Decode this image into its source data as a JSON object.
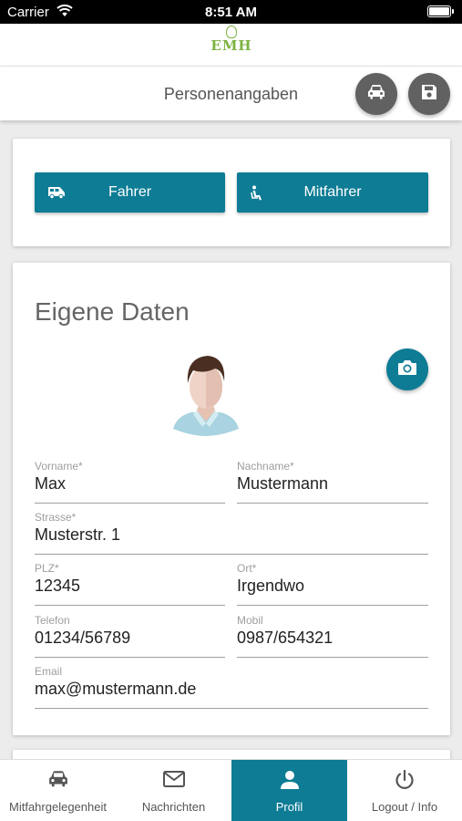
{
  "status_bar": {
    "carrier": "Carrier",
    "time": "8:51 AM"
  },
  "logo": {
    "text": "EMH"
  },
  "header": {
    "title": "Personenangaben",
    "car_icon": "car-icon",
    "save_icon": "floppy-disk-icon"
  },
  "roles": {
    "driver": {
      "label": "Fahrer",
      "icon": "van-icon"
    },
    "passenger": {
      "label": "Mitfahrer",
      "icon": "seated-person-icon"
    }
  },
  "profile": {
    "heading": "Eigene Daten",
    "camera_icon": "camera-icon",
    "fields": {
      "vorname": {
        "label": "Vorname*",
        "value": "Max"
      },
      "nachname": {
        "label": "Nachname*",
        "value": "Mustermann"
      },
      "strasse": {
        "label": "Strasse*",
        "value": "Musterstr. 1"
      },
      "plz": {
        "label": "PLZ*",
        "value": "12345"
      },
      "ort": {
        "label": "Ort*",
        "value": "Irgendwo"
      },
      "telefon": {
        "label": "Telefon",
        "value": "01234/56789"
      },
      "mobil": {
        "label": "Mobil",
        "value": "0987/654321"
      },
      "email": {
        "label": "Email",
        "value": "max@mustermann.de"
      }
    }
  },
  "tabs": [
    {
      "label": "Mitfahrgelegenheit",
      "icon": "car-icon",
      "active": false
    },
    {
      "label": "Nachrichten",
      "icon": "envelope-icon",
      "active": false
    },
    {
      "label": "Profil",
      "icon": "person-icon",
      "active": true
    },
    {
      "label": "Logout / Info",
      "icon": "power-icon",
      "active": false
    }
  ],
  "colors": {
    "accent": "#0e7c95",
    "header_buttons": "#616161",
    "logo_green": "#7cb342"
  }
}
